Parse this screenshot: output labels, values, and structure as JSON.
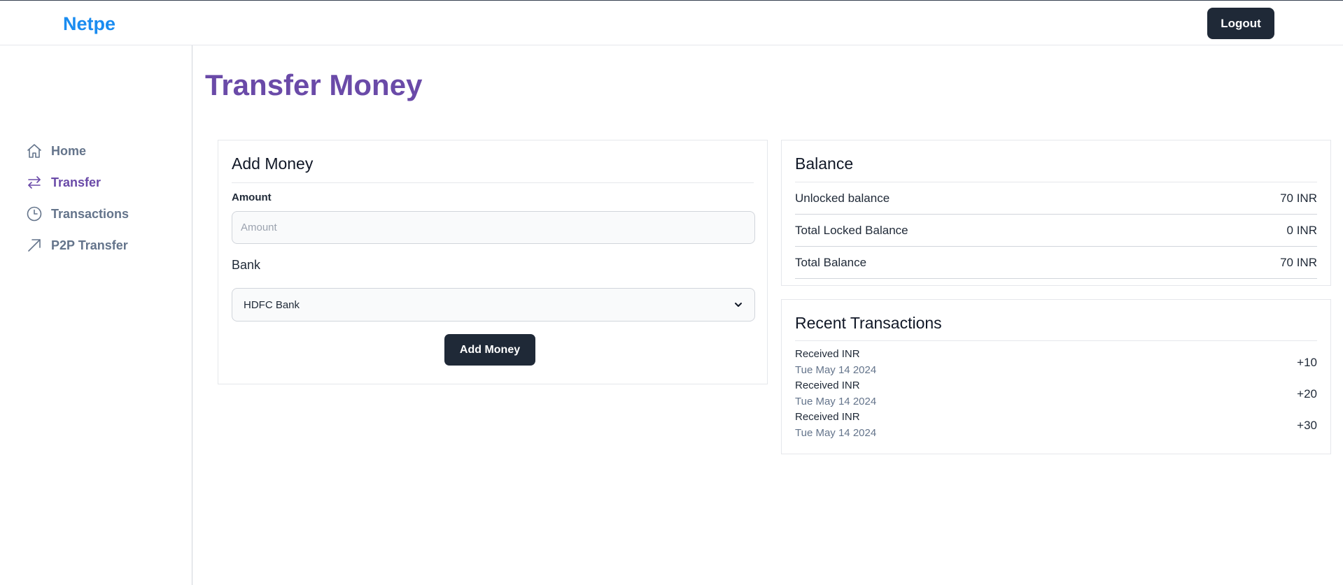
{
  "header": {
    "logo": "Netpe",
    "logout_label": "Logout"
  },
  "sidebar": {
    "items": [
      {
        "label": "Home",
        "icon": "home-icon",
        "active": false
      },
      {
        "label": "Transfer",
        "icon": "transfer-arrows-icon",
        "active": true
      },
      {
        "label": "Transactions",
        "icon": "clock-icon",
        "active": false
      },
      {
        "label": "P2P Transfer",
        "icon": "arrow-up-right-icon",
        "active": false
      }
    ]
  },
  "main": {
    "title": "Transfer Money",
    "add_money": {
      "title": "Add Money",
      "amount_label": "Amount",
      "amount_placeholder": "Amount",
      "amount_value": "",
      "bank_label": "Bank",
      "bank_selected": "HDFC Bank",
      "button_label": "Add Money"
    },
    "balance": {
      "title": "Balance",
      "rows": [
        {
          "label": "Unlocked balance",
          "value": "70 INR"
        },
        {
          "label": "Total Locked Balance",
          "value": "0 INR"
        },
        {
          "label": "Total Balance",
          "value": "70 INR"
        }
      ]
    },
    "recent_transactions": {
      "title": "Recent Transactions",
      "items": [
        {
          "title": "Received INR",
          "date": "Tue May 14 2024",
          "amount": "+10"
        },
        {
          "title": "Received INR",
          "date": "Tue May 14 2024",
          "amount": "+20"
        },
        {
          "title": "Received INR",
          "date": "Tue May 14 2024",
          "amount": "+30"
        }
      ]
    }
  },
  "colors": {
    "brand": "#1a8cf0",
    "accent_purple": "#6a4aa8",
    "dark_button": "#1f2937",
    "muted_text": "#64748b"
  }
}
